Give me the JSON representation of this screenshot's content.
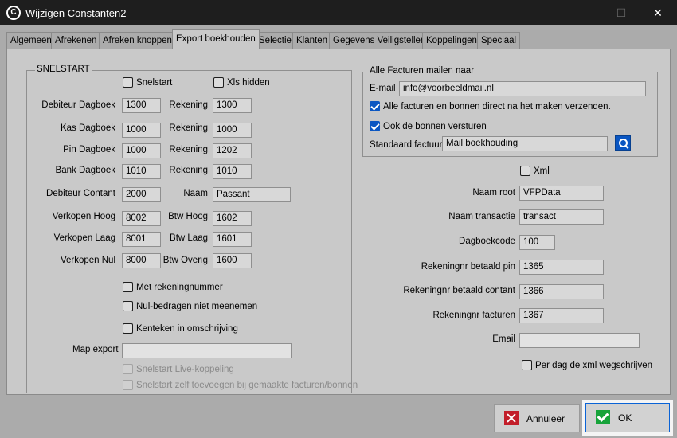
{
  "window": {
    "title": "Wijzigen Constanten2",
    "icon_glyph": "C",
    "minimize_glyph": "—",
    "maximize_glyph": "☐",
    "close_glyph": "✕"
  },
  "tabs": [
    {
      "label": "Algemeen"
    },
    {
      "label": "Afrekenen"
    },
    {
      "label": "Afreken knoppen"
    },
    {
      "label": "Export boekhouden",
      "active": true
    },
    {
      "label": "Selectie"
    },
    {
      "label": "Klanten"
    },
    {
      "label": "Gegevens Veiligstellen"
    },
    {
      "label": "Koppelingen"
    },
    {
      "label": "Speciaal"
    }
  ],
  "snelstart": {
    "legend": "SNELSTART",
    "snelstart_chk": "Snelstart",
    "xls_chk": "Xls hidden",
    "rows": [
      {
        "label": "Debiteur Dagboek",
        "value": "1300",
        "label2": "Rekening",
        "value2": "1300"
      },
      {
        "label": "Kas  Dagboek",
        "value": "1000",
        "label2": "Rekening",
        "value2": "1000"
      },
      {
        "label": "Pin  Dagboek",
        "value": "1000",
        "label2": "Rekening",
        "value2": "1202"
      },
      {
        "label": "Bank Dagboek",
        "value": "1010",
        "label2": "Rekening",
        "value2": "1010"
      },
      {
        "label": "Debiteur  Contant",
        "value": "2000",
        "label2": "Naam",
        "value2": "Passant"
      },
      {
        "label": "Verkopen Hoog",
        "value": "8002",
        "label2": "Btw Hoog",
        "value2": "1602"
      },
      {
        "label": "Verkopen Laag",
        "value": "8001",
        "label2": "Btw Laag",
        "value2": "1601"
      },
      {
        "label": "Verkopen Nul",
        "value": "8000",
        "label2": "Btw Overig",
        "value2": "1600"
      }
    ],
    "met_rekeningnummer": "Met rekeningnummer",
    "nul_bedragen": "Nul-bedragen niet meenemen",
    "kenteken": "Kenteken in omschrijving",
    "map_export_label": "Map export",
    "map_export_value": "",
    "live_koppeling": "Snelstart Live-koppeling",
    "zelf_toevoegen": "Snelstart zelf toevoegen bij gemaakte facturen/bonnen"
  },
  "mail": {
    "legend": "Alle Facturen mailen naar",
    "email_label": "E-mail",
    "email_value": "info@voorbeeldmail.nl",
    "direct_chk": "Alle facturen en bonnen direct na het maken verzenden.",
    "bonnen_chk": "Ook de bonnen versturen",
    "standaard_label": "Standaard factuur",
    "standaard_value": "Mail boekhouding"
  },
  "xml": {
    "xml_chk": "Xml",
    "rows": [
      {
        "label": "Naam root",
        "value": "VFPData"
      },
      {
        "label": "Naam transactie",
        "value": "transact"
      },
      {
        "label": "Dagboekcode",
        "value": "100"
      },
      {
        "label": "Rekeningnr betaald pin",
        "value": "1365"
      },
      {
        "label": "Rekeningnr betaald contant",
        "value": "1366"
      },
      {
        "label": "Rekeningnr facturen",
        "value": "1367"
      },
      {
        "label": "Email",
        "value": ""
      }
    ],
    "per_dag_chk": "Per dag de xml wegschrijven"
  },
  "buttons": {
    "cancel": "Annuleer",
    "ok": "OK"
  }
}
